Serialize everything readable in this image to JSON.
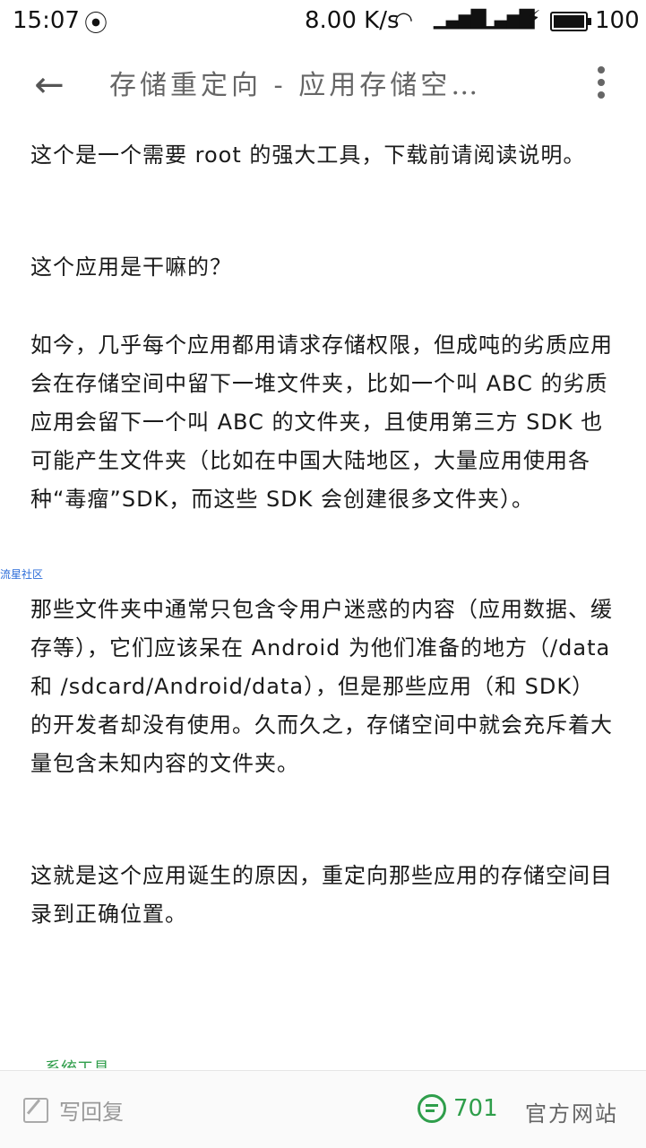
{
  "status_bar": {
    "time": "15:07",
    "carrier_icon": "घ",
    "speed": "8.00 K/s",
    "network_label": "4G",
    "battery": "100"
  },
  "app_bar": {
    "title": "存储重定向 - 应用存储空…"
  },
  "content": {
    "p1": "这个是一个需要 root 的强大工具，下载前请阅读说明。",
    "p2": "这个应用是干嘛的？",
    "p3": "如今，几乎每个应用都用请求存储权限，但成吨的劣质应用会在存储空间中留下一堆文件夹，比如一个叫 ABC 的劣质应用会留下一个叫 ABC 的文件夹，且使用第三方 SDK 也可能产生文件夹（比如在中国大陆地区，大量应用使用各种“毒瘤”SDK，而这些 SDK 会创建很多文件夹）。",
    "p4": "那些文件夹中通常只包含令用户迷惑的内容（应用数据、缓存等），它们应该呆在 Android 为他们准备的地方（/data 和 /sdcard/Android/data），但是那些应用（和 SDK）的开发者却没有使用。久而久之，存储空间中就会充斥着大量包含未知内容的文件夹。",
    "p5": "这就是这个应用诞生的原因，重定向那些应用的存储空间目录到正确位置。",
    "watermark": "流星社区",
    "partial_section": "系统工具"
  },
  "bottom_bar": {
    "reply_label": "写回复",
    "comment_count": "701",
    "website_label": "官方网站"
  },
  "colors": {
    "accent_green": "#2f9e4b",
    "watermark_blue": "#2a6bd8"
  }
}
